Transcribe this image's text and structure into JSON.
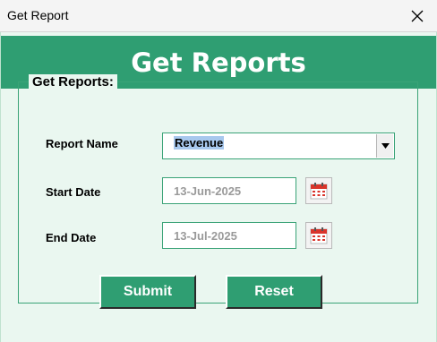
{
  "window": {
    "title": "Get Report"
  },
  "banner": {
    "title": "Get Reports"
  },
  "group": {
    "legend": "Get Reports:"
  },
  "fields": {
    "report_name": {
      "label": "Report Name",
      "value": "Revenue"
    },
    "start_date": {
      "label": "Start Date",
      "value": "13-Jun-2025"
    },
    "end_date": {
      "label": "End Date",
      "value": "13-Jul-2025"
    }
  },
  "buttons": {
    "submit": "Submit",
    "reset": "Reset"
  },
  "icons": {
    "close": "close-icon",
    "dropdown": "dropdown-arrow-icon",
    "calendar": "calendar-icon"
  },
  "colors": {
    "accent": "#2f9e72",
    "background": "#eaf7f0",
    "selection": "#a8c8ee"
  }
}
